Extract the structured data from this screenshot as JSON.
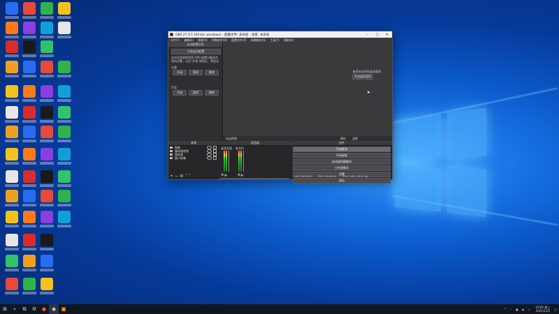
{
  "obs": {
    "title": "OBS 27.0.1 (64-bit, windows) - 配置文件: 未命名 - 场景: 未命名",
    "menu": [
      "文件(F)",
      "编辑(E)",
      "视图(V)",
      "停靠部件(D)",
      "配置文件(P)",
      "场景集合(S)",
      "工具(T)",
      "帮助(H)"
    ],
    "wizard": {
      "header": "自动配置向导",
      "start_button": "开始自动配置",
      "hint": "本向导会帮助您将 OBS 配置为最适合您的设置。点击“开始”按钮后，将会运行测试，然后显示推荐设置",
      "main_label": "主要",
      "audio_label": "声音",
      "buttons_row1": [
        "开始",
        "暂停",
        "删除"
      ],
      "buttons_row2": [
        "开始",
        "暂停",
        "删除"
      ]
    },
    "preview": {
      "message": "推荐启动OBS虚拟相机",
      "button": "开启虚拟相机"
    },
    "toolbar": {
      "label": "未选择源",
      "properties": "属性",
      "filters": "滤镜"
    },
    "sources": {
      "header": "来源",
      "items": [
        "图像",
        "媒体源视频",
        "游戏源",
        "窗口采集"
      ]
    },
    "mixer": {
      "header": "混音器",
      "channels": [
        "桌面音频",
        "麦克风"
      ]
    },
    "controls": {
      "header": "控件",
      "buttons": [
        "开始推流",
        "开始录制",
        "启动虚拟摄像机",
        "工作室模式",
        "设置",
        "退出"
      ]
    },
    "status": {
      "live": "LIVE: 00:00:00",
      "rec": "REC: 00:00:00",
      "cpu": "CPU: 0.8%, 30.00 fps"
    }
  },
  "taskbar": {
    "start_icon": "windows-logo",
    "tray_time": "19:05 周三",
    "tray_date": "2021/12/1"
  },
  "colors": {
    "obs_bg": "#2b2b2e",
    "taskbar": "#101622",
    "desktop": "#0b58c9"
  }
}
